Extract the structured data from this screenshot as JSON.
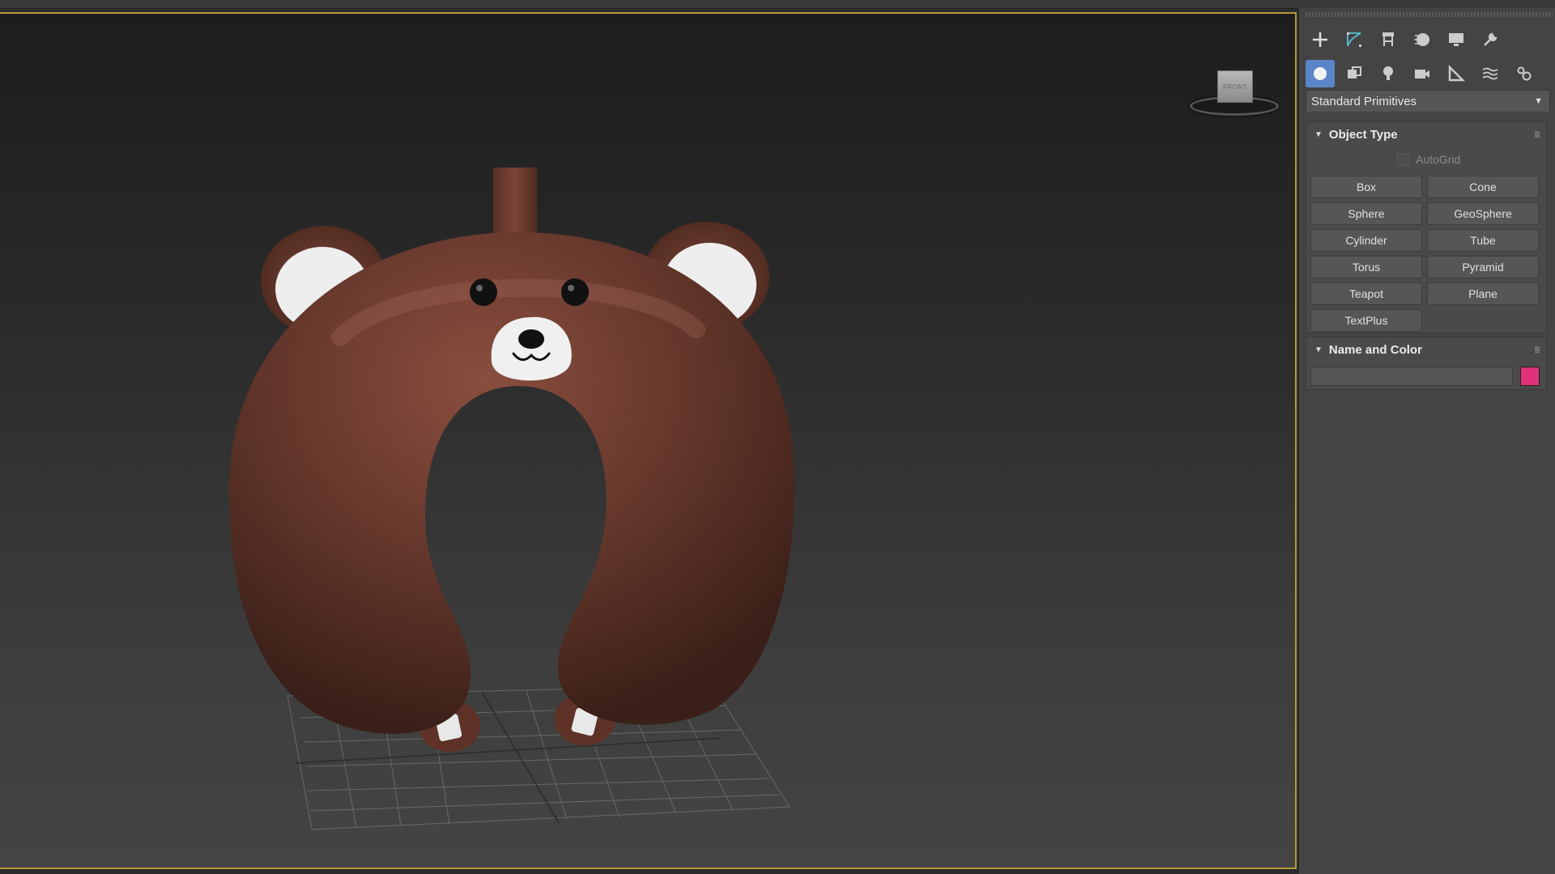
{
  "viewport": {
    "viewcube_label": "FRONT"
  },
  "command_panel": {
    "main_tabs": [
      {
        "icon": "create-icon"
      },
      {
        "icon": "modify-icon"
      },
      {
        "icon": "hierarchy-icon"
      },
      {
        "icon": "motion-icon"
      },
      {
        "icon": "display-icon"
      },
      {
        "icon": "utilities-icon"
      }
    ],
    "category_tabs": [
      {
        "icon": "geometry-icon",
        "active": true
      },
      {
        "icon": "shapes-icon"
      },
      {
        "icon": "lights-icon"
      },
      {
        "icon": "cameras-icon"
      },
      {
        "icon": "helpers-icon"
      },
      {
        "icon": "space-warps-icon"
      },
      {
        "icon": "systems-icon"
      }
    ],
    "dropdown_value": "Standard Primitives",
    "object_type": {
      "title": "Object Type",
      "autogrid_label": "AutoGrid",
      "buttons": [
        "Box",
        "Cone",
        "Sphere",
        "GeoSphere",
        "Cylinder",
        "Tube",
        "Torus",
        "Pyramid",
        "Teapot",
        "Plane",
        "TextPlus"
      ]
    },
    "name_and_color": {
      "title": "Name and Color",
      "name_value": "",
      "color": "#e0307a"
    }
  },
  "colors": {
    "active_tab": "#5c85c9",
    "viewport_border": "#b59a3c",
    "pillow_brown": "#6a3a2e"
  }
}
